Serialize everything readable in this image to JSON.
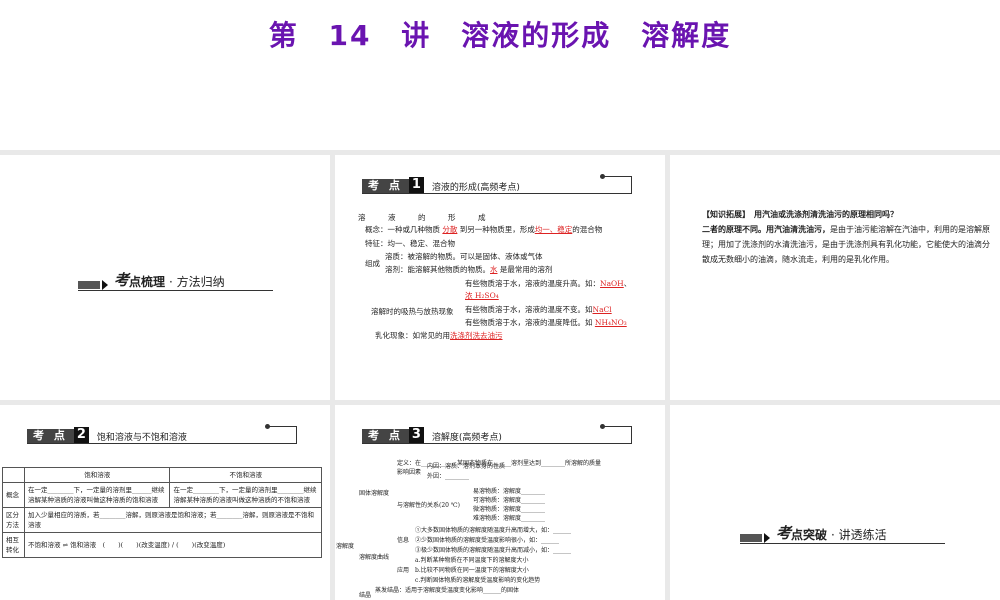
{
  "title": "第 14 讲　溶液的形成　溶解度",
  "slide1": {
    "prefix": "考",
    "t2": "点梳理",
    "t3": "· 方法归纳"
  },
  "slide2": {
    "tag": "考 点",
    "num": "1",
    "header": "溶液的形成(高频考点)",
    "lines": [
      "溶　　　液　　　的　　　形　　　成"
    ],
    "concept": {
      "a": "概念：一种或几种物质",
      "b": "分散",
      "c": "到另一种物质里，形成",
      "d": "均一、稳定",
      "e": "的混合物"
    },
    "feature": "特征：均一、稳定、混合物",
    "comp_label": "组成",
    "solute": "溶质：被溶解的物质。可以是固体、液体或气体",
    "solvent_a": "溶剂：能溶解其他物质的物质。",
    "solvent_b": "水",
    "solvent_c": "是最常用的溶剂",
    "heat_label": "溶解时的吸热与放热现象",
    "heat1": "有些物质溶于水，溶液的温度升高。如：",
    "heat1_ans": "NaOH",
    "heat1_ans2": "浓 H₂SO₄",
    "heat2": "有些物质溶于水，溶液的温度不变。如",
    "heat2_ans": "NaCl",
    "heat3": "有些物质溶于水，溶液的温度降低。如",
    "heat3_ans": "NH₄NO₃",
    "emul": "乳化现象：如常见的用",
    "emul_ans": "洗涤剂洗去油污"
  },
  "slide3": {
    "q_label": "【知识拓展】",
    "q": "用汽油或洗涤剂清洗油污的原理相同吗？",
    "a_bold": "二者的原理不同。用汽油清洗油污，",
    "a": "是由于油污能溶解在汽油中，利用的是溶解原理；用加了洗涤剂的水清洗油污，是由于洗涤剂具有乳化功能，它能使大的油滴分散成无数细小的油滴，随水流走，利用的是乳化作用。"
  },
  "slide4": {
    "tag": "考 点",
    "num": "2",
    "header": "饱和溶液与不饱和溶液",
    "table": {
      "headers": [
        "",
        "饱和溶液",
        "不饱和溶液"
      ],
      "rows": [
        [
          "概念",
          "在一定________下，一定量的溶剂里______继续溶解某种溶质的溶液叫做这种溶质的饱和溶液",
          "在一定________下，一定量的溶剂里________继续溶解某种溶质的溶液叫做这种溶质的不饱和溶液"
        ],
        [
          "区分方法",
          "加入少量相应的溶质，若________溶解，则原溶液是饱和溶液；若________溶解，则原溶液是不饱和溶液"
        ],
        [
          "相互转化",
          "不饱和溶液 ⇌ 饱和溶液　(　　)(　　)(改变温度) / (　　)(改变温度)"
        ]
      ]
    }
  },
  "slide5": {
    "tag": "考 点",
    "num": "3",
    "header": "溶解度(高频考点)",
    "root": "溶解度",
    "solid": "固体溶解度",
    "curve": "溶解度曲线",
    "cryst": "结晶",
    "def": "定义：在__________，某固态物质在______溶剂里达到________所溶解的质量",
    "factor": "影响因素",
    "inner": "内因：溶质、溶剂本身的性质",
    "outer": "外因：________",
    "rel": "与溶解性的关系(20 ℃)",
    "rels": [
      "易溶物质：溶解度________",
      "可溶物质：溶解度________",
      "微溶物质：溶解度________",
      "难溶物质：溶解度________"
    ],
    "info": "信息",
    "infos": [
      "①大多数固体物质的溶解度随温度升高而增大，如：______",
      "②少数固体物质的溶解度受温度影响很小，如：______",
      "③极少数固体物质的溶解度随温度升高而减小，如：______"
    ],
    "app": "应用",
    "apps": [
      "a.判断某种物质在不同温度下的溶解度大小",
      "b.比较不同物质在同一温度下的溶解度大小",
      "c.判断固体物质的溶解度受温度影响的变化趋势"
    ],
    "evap": "蒸发结晶：适用于溶解度受温度变化影响______的固体"
  },
  "slide6": {
    "prefix": "考",
    "t2": "点突破",
    "t3": "· 讲透练活"
  }
}
